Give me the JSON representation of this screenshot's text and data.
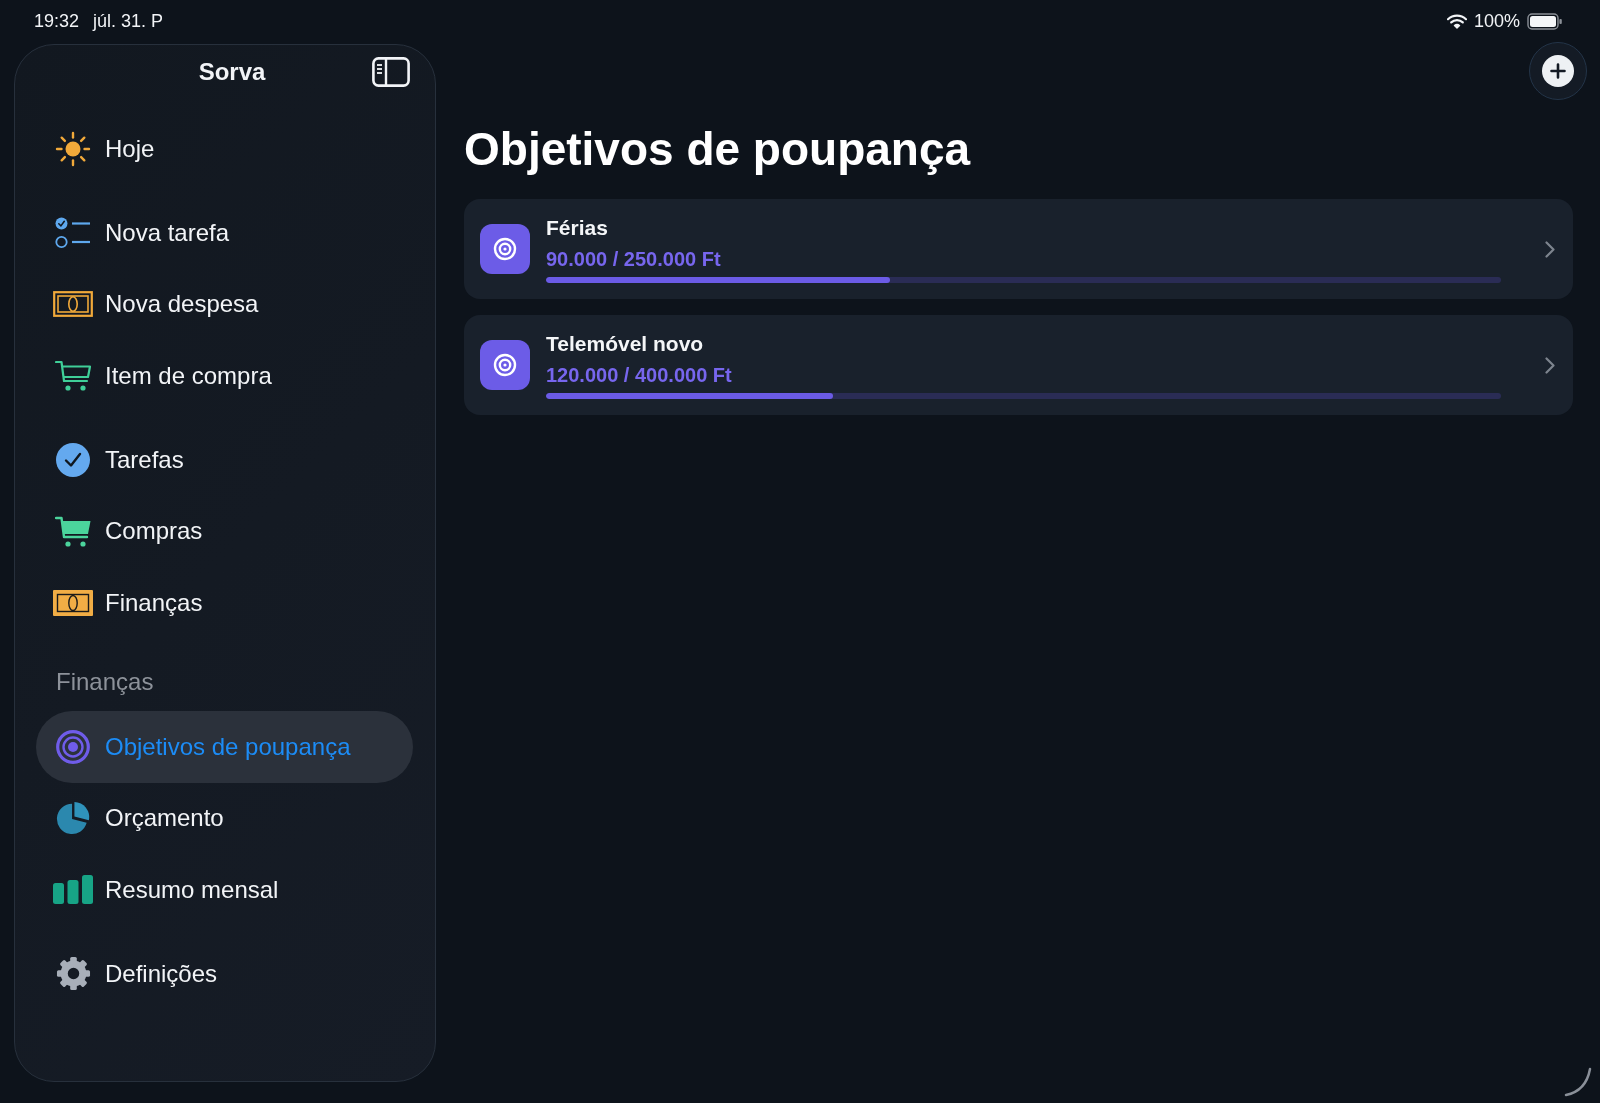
{
  "status_bar": {
    "time": "19:32",
    "date": "júl. 31. P",
    "battery": "100%"
  },
  "sidebar": {
    "title": "Sorva",
    "groups": [
      {
        "items": [
          {
            "label": "Hoje",
            "selected": false
          }
        ]
      },
      {
        "items": [
          {
            "label": "Nova tarefa",
            "selected": false
          },
          {
            "label": "Nova despesa",
            "selected": false
          },
          {
            "label": "Item de compra",
            "selected": false
          }
        ]
      },
      {
        "items": [
          {
            "label": "Tarefas",
            "selected": false
          },
          {
            "label": "Compras",
            "selected": false
          },
          {
            "label": "Finanças",
            "selected": false
          }
        ]
      },
      {
        "heading": "Finanças",
        "items": [
          {
            "label": "Objetivos de poupança",
            "selected": true
          },
          {
            "label": "Orçamento",
            "selected": false
          },
          {
            "label": "Resumo mensal",
            "selected": false
          }
        ]
      },
      {
        "items": [
          {
            "label": "Definições",
            "selected": false
          }
        ]
      }
    ]
  },
  "main": {
    "title": "Objetivos de poupança",
    "goals": [
      {
        "name": "Férias",
        "amount": "90.000 / 250.000 Ft",
        "level": 0.36
      },
      {
        "name": "Telemóvel novo",
        "amount": "120.000 / 400.000 Ft",
        "level": 0.3
      }
    ]
  }
}
